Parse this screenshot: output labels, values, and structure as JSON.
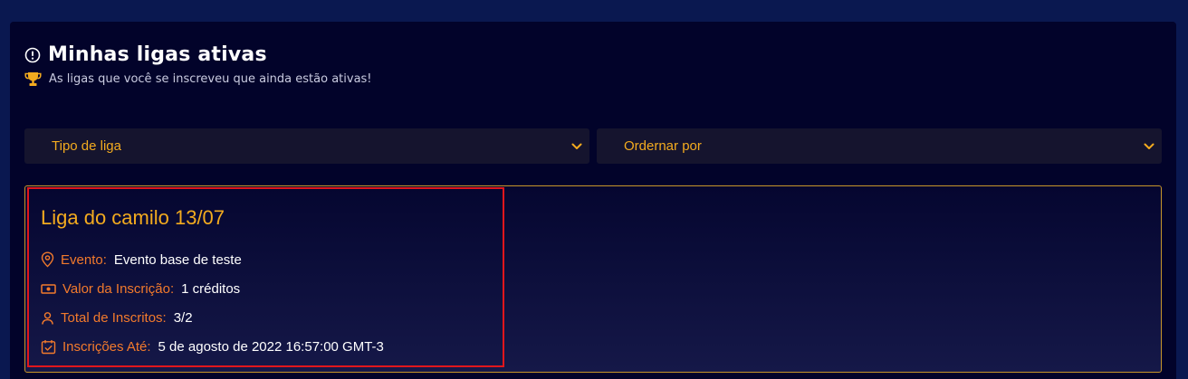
{
  "header": {
    "title": "Minhas ligas ativas",
    "title_icon": "alert-circle-icon",
    "subtitle": "As ligas que você se inscreveu que ainda estão ativas!",
    "subtitle_icon": "trophy-icon"
  },
  "filters": {
    "league_type": {
      "value": "Tipo de liga"
    },
    "order_by": {
      "value": "Ordernar por"
    }
  },
  "league": {
    "title": "Liga do camilo 13/07",
    "rows": [
      {
        "icon": "map-pin-icon",
        "label": "Evento:",
        "value": "Evento base de teste"
      },
      {
        "icon": "money-icon",
        "label": "Valor da Inscrição:",
        "value": "1 créditos"
      },
      {
        "icon": "user-icon",
        "label": "Total de Inscritos:",
        "value": "3/2"
      },
      {
        "icon": "calendar-check-icon",
        "label": "Inscrições Até:",
        "value": "5 de agosto de 2022 16:57:00 GMT-3"
      }
    ]
  },
  "colors": {
    "accent_yellow": "#f3ab1f",
    "label_orange": "#f27a2c",
    "highlight_red": "#e0161c",
    "background": "#02032a"
  }
}
